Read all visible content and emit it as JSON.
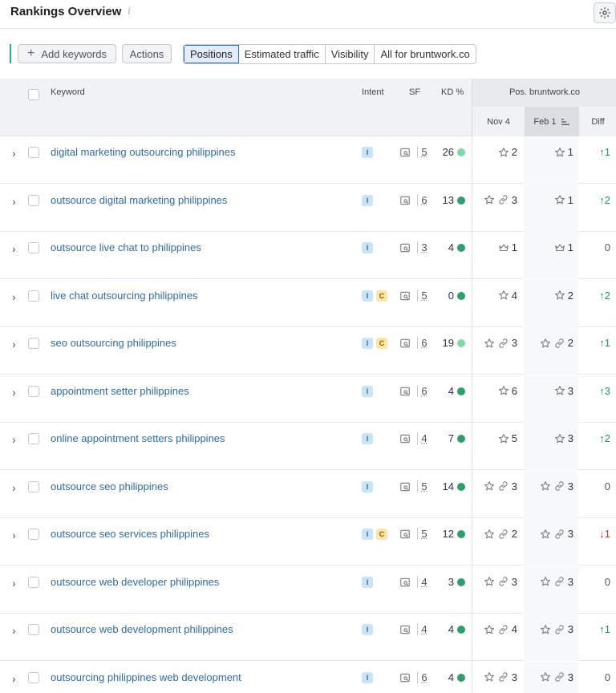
{
  "header": {
    "title": "Rankings Overview",
    "info_icon": "info-icon",
    "settings_icon": "gear-icon"
  },
  "toolbar": {
    "add_keywords_label": "Add keywords",
    "actions_label": "Actions",
    "tabs": [
      "Positions",
      "Estimated traffic",
      "Visibility",
      "All for bruntwork.co"
    ],
    "active_tab": "Positions"
  },
  "table": {
    "columns": {
      "keyword": "Keyword",
      "intent": "Intent",
      "sf": "SF",
      "kd": "KD %",
      "pos_group": "Pos. bruntwork.co",
      "nov": "Nov 4",
      "feb": "Feb 1",
      "diff": "Diff"
    },
    "colors": {
      "kd_light_green": "#7ed9a6",
      "kd_green": "#2e9e6b",
      "up": "#1a9a5a",
      "down": "#c0392b"
    },
    "rows": [
      {
        "keyword": "digital marketing outsourcing philippines",
        "intent": [
          "I"
        ],
        "sf": "5",
        "kd": "26",
        "kd_color": "light",
        "nov": "2",
        "nov_link": false,
        "nov_icon": "star",
        "feb": "1",
        "feb_link": false,
        "feb_icon": "star",
        "diff": "↑1",
        "diff_dir": "up"
      },
      {
        "keyword": "outsource digital marketing philippines",
        "intent": [
          "I"
        ],
        "sf": "6",
        "kd": "13",
        "kd_color": "green",
        "nov": "3",
        "nov_link": true,
        "nov_icon": "star",
        "feb": "1",
        "feb_link": false,
        "feb_icon": "star",
        "diff": "↑2",
        "diff_dir": "up"
      },
      {
        "keyword": "outsource live chat to philippines",
        "intent": [
          "I"
        ],
        "sf": "3",
        "kd": "4",
        "kd_color": "green",
        "nov": "1",
        "nov_link": false,
        "nov_icon": "crown",
        "feb": "1",
        "feb_link": false,
        "feb_icon": "crown",
        "diff": "0",
        "diff_dir": "zero"
      },
      {
        "keyword": "live chat outsourcing philippines",
        "intent": [
          "I",
          "C"
        ],
        "sf": "5",
        "kd": "0",
        "kd_color": "green",
        "nov": "4",
        "nov_link": false,
        "nov_icon": "star",
        "feb": "2",
        "feb_link": false,
        "feb_icon": "star",
        "diff": "↑2",
        "diff_dir": "up"
      },
      {
        "keyword": "seo outsourcing philippines",
        "intent": [
          "I",
          "C"
        ],
        "sf": "6",
        "kd": "19",
        "kd_color": "light",
        "nov": "3",
        "nov_link": true,
        "nov_icon": "star",
        "feb": "2",
        "feb_link": true,
        "feb_icon": "star",
        "diff": "↑1",
        "diff_dir": "up"
      },
      {
        "keyword": "appointment setter philippines",
        "intent": [
          "I"
        ],
        "sf": "6",
        "kd": "4",
        "kd_color": "green",
        "nov": "6",
        "nov_link": false,
        "nov_icon": "star",
        "feb": "3",
        "feb_link": false,
        "feb_icon": "star",
        "diff": "↑3",
        "diff_dir": "up"
      },
      {
        "keyword": "online appointment setters philippines",
        "intent": [
          "I"
        ],
        "sf": "4",
        "kd": "7",
        "kd_color": "green",
        "nov": "5",
        "nov_link": false,
        "nov_icon": "star",
        "feb": "3",
        "feb_link": false,
        "feb_icon": "star",
        "diff": "↑2",
        "diff_dir": "up"
      },
      {
        "keyword": "outsource seo philippines",
        "intent": [
          "I"
        ],
        "sf": "5",
        "kd": "14",
        "kd_color": "green",
        "nov": "3",
        "nov_link": true,
        "nov_icon": "star",
        "feb": "3",
        "feb_link": true,
        "feb_icon": "star",
        "diff": "0",
        "diff_dir": "zero"
      },
      {
        "keyword": "outsource seo services philippines",
        "intent": [
          "I",
          "C"
        ],
        "sf": "5",
        "kd": "12",
        "kd_color": "green",
        "nov": "2",
        "nov_link": true,
        "nov_icon": "star",
        "feb": "3",
        "feb_link": true,
        "feb_icon": "star",
        "diff": "↓1",
        "diff_dir": "down"
      },
      {
        "keyword": "outsource web developer philippines",
        "intent": [
          "I"
        ],
        "sf": "4",
        "kd": "3",
        "kd_color": "green",
        "nov": "3",
        "nov_link": true,
        "nov_icon": "star",
        "feb": "3",
        "feb_link": true,
        "feb_icon": "star",
        "diff": "0",
        "diff_dir": "zero"
      },
      {
        "keyword": "outsource web development philippines",
        "intent": [
          "I"
        ],
        "sf": "4",
        "kd": "4",
        "kd_color": "green",
        "nov": "4",
        "nov_link": true,
        "nov_icon": "star",
        "feb": "3",
        "feb_link": true,
        "feb_icon": "star",
        "diff": "↑1",
        "diff_dir": "up"
      },
      {
        "keyword": "outsourcing philippines web development",
        "intent": [
          "I"
        ],
        "sf": "6",
        "kd": "4",
        "kd_color": "green",
        "nov": "3",
        "nov_link": true,
        "nov_icon": "star",
        "feb": "3",
        "feb_link": true,
        "feb_icon": "star",
        "diff": "0",
        "diff_dir": "zero"
      }
    ]
  }
}
